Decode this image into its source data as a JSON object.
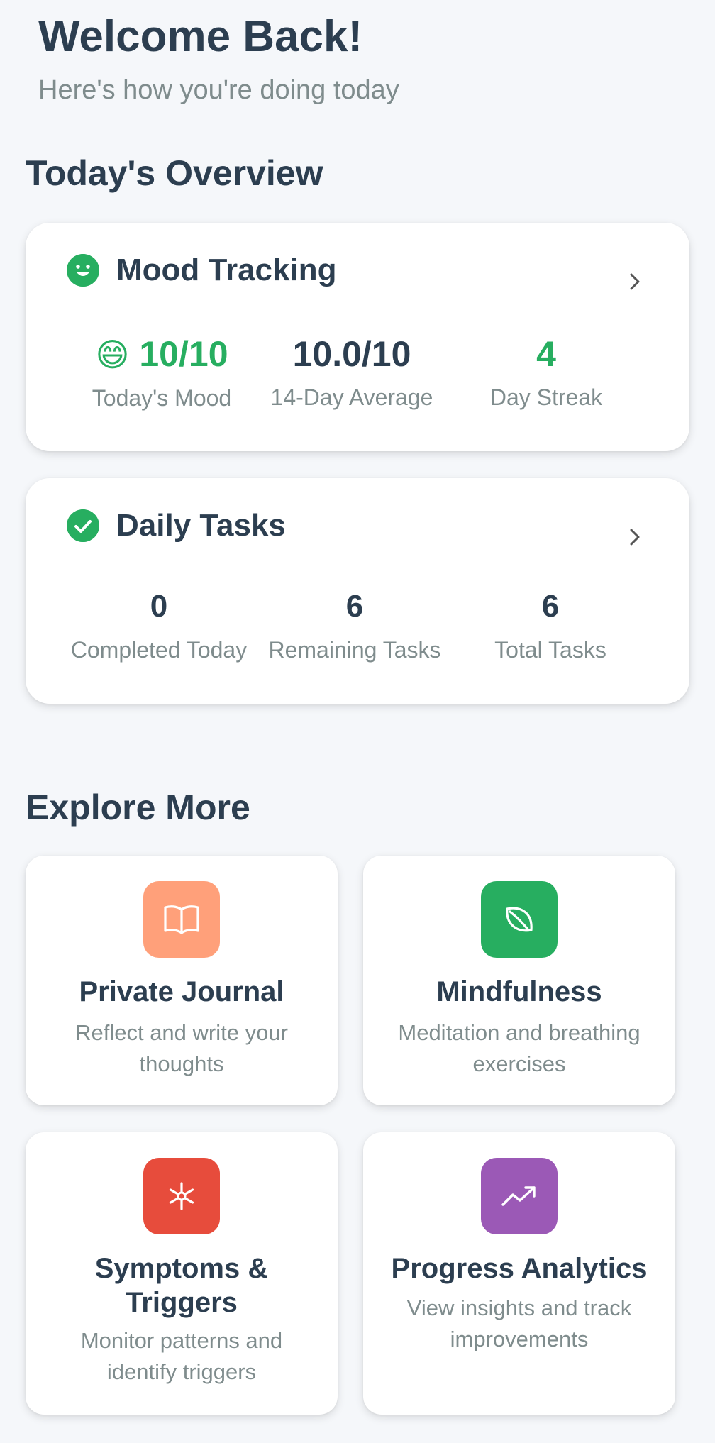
{
  "header": {
    "title": "Welcome Back!",
    "subtitle": "Here's how you're doing today"
  },
  "overview": {
    "section_title": "Today's Overview",
    "mood": {
      "title": "Mood Tracking",
      "icon": "smile-icon",
      "emoji": "😄",
      "todays_mood_value": "10/10",
      "todays_mood_label": "Today's Mood",
      "average_value": "10.0/10",
      "average_label": "14-Day Average",
      "streak_value": "4",
      "streak_label": "Day Streak"
    },
    "tasks": {
      "title": "Daily Tasks",
      "icon": "check-circle-icon",
      "completed_value": "0",
      "completed_label": "Completed Today",
      "remaining_value": "6",
      "remaining_label": "Remaining Tasks",
      "total_value": "6",
      "total_label": "Total Tasks"
    }
  },
  "explore": {
    "section_title": "Explore More",
    "tiles": [
      {
        "title": "Private Journal",
        "description": "Reflect and write your thoughts",
        "icon": "book-icon",
        "color": "#ffa07a"
      },
      {
        "title": "Mindfulness",
        "description": "Meditation and breathing exercises",
        "icon": "leaf-icon",
        "color": "#27ae60"
      },
      {
        "title": "Symptoms & Triggers",
        "description": "Monitor patterns and identify triggers",
        "icon": "asterisk-icon",
        "color": "#e74c3c"
      },
      {
        "title": "Progress Analytics",
        "description": "View insights and track improvements",
        "icon": "trend-up-icon",
        "color": "#9b59b6"
      }
    ]
  },
  "colors": {
    "accent_green": "#27ae60",
    "text_dark": "#2c3e50",
    "text_muted": "#7f8c8d",
    "background": "#f5f7fa"
  }
}
